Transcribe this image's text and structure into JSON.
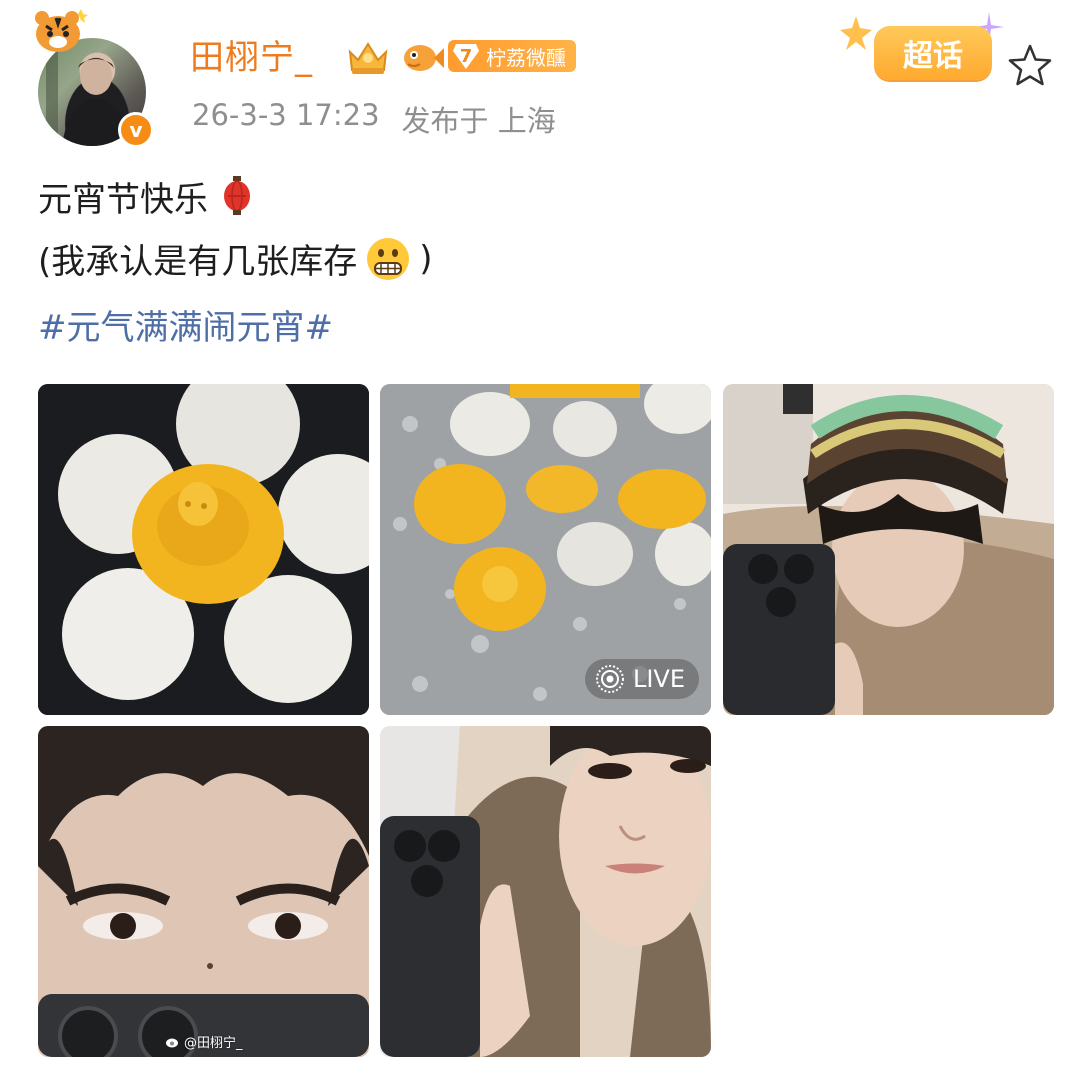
{
  "post": {
    "username": "田栩宁_",
    "fan_badge": {
      "level": "7",
      "label": "柠荔微醺"
    },
    "time": "26-3-3 17:23",
    "location": "发布于 上海",
    "chaohua_label": "超话",
    "text_line1": "元宵节快乐",
    "text_line2_open": "(我承认是有几张库存",
    "text_line2_close": ")",
    "hashtag": "#元气满满闹元宵#",
    "verified_mark": "v"
  },
  "images": [
    {
      "name": "tangyuan-bowl-photo"
    },
    {
      "name": "tangyuan-boiling-photo",
      "live_label": "LIVE"
    },
    {
      "name": "selfie-beanie-photo"
    },
    {
      "name": "eyes-closeup-photo",
      "watermark": "@田栩宁_"
    },
    {
      "name": "selfie-fur-collar-photo"
    }
  ],
  "colors": {
    "username": "#ef7b1f",
    "hashtag": "#4d6ea7",
    "meta": "#8f8f8f",
    "verified": "#f78c14",
    "chaohua": "#ffb13a"
  },
  "icons": [
    "tiger-icon",
    "crown-badge-icon",
    "fish-badge-icon",
    "lantern-icon",
    "grimace-emoji-icon",
    "live-icon",
    "star-icon",
    "weibo-logo-icon"
  ]
}
